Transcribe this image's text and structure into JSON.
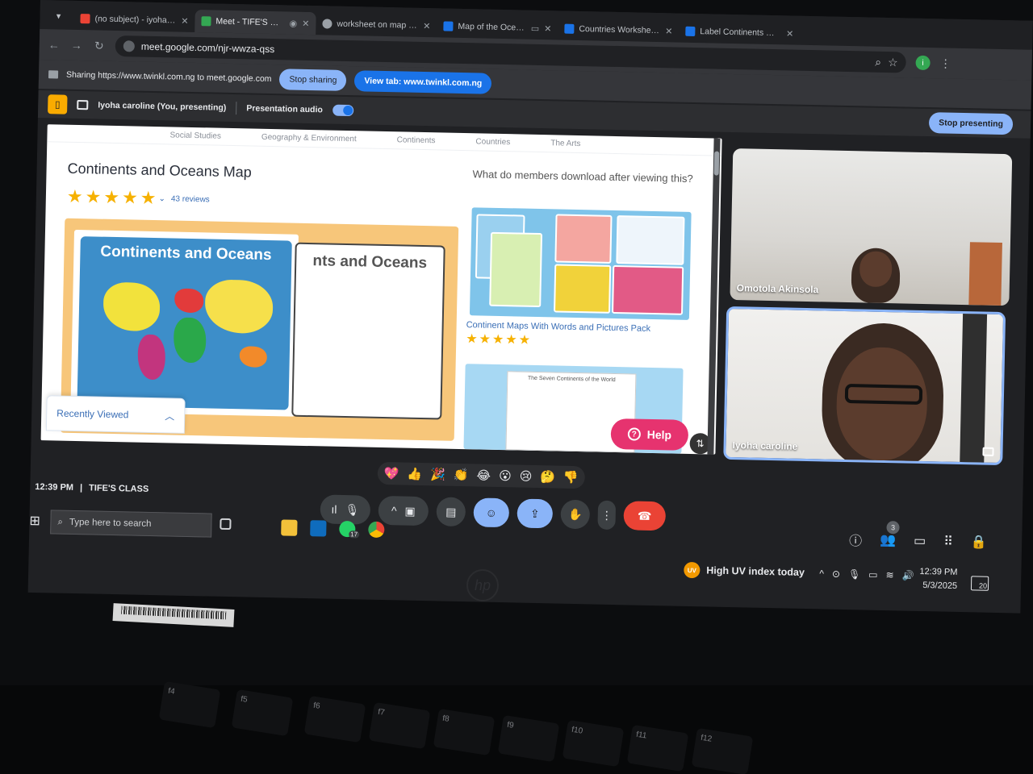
{
  "browser": {
    "tabs": [
      {
        "label": "(no subject) - iyohacaroline",
        "favicon_color": "#ea4335"
      },
      {
        "label": "Meet - TIFE'S CLASS",
        "favicon_color": "#34a853",
        "active": true
      },
      {
        "label": "worksheet on map continents",
        "favicon_color": "#9aa0a6"
      },
      {
        "label": "Map of the Oceans and",
        "favicon_color": "#1a73e8"
      },
      {
        "label": "Countries Worksheets & Pri",
        "favicon_color": "#1a73e8"
      },
      {
        "label": "Label Continents Worksheet",
        "favicon_color": "#1a73e8"
      }
    ],
    "url": "meet.google.com/njr-wwza-qss",
    "profile_initial": "i"
  },
  "sharebar": {
    "text": "Sharing https://www.twinkl.com.ng to meet.google.com",
    "stop_label": "Stop sharing",
    "view_label": "View tab: www.twinkl.com.ng"
  },
  "presentbar": {
    "presenter": "Iyoha caroline (You, presenting)",
    "audio_label": "Presentation audio",
    "stop_label": "Stop presenting"
  },
  "webpage": {
    "nav": [
      "Social Studies",
      "Geography & Environment",
      "Continents",
      "Countries",
      "The Arts"
    ],
    "title": "Continents and Oceans Map",
    "rating": 5,
    "reviews": "43 reviews",
    "preview_front_title": "Continents and Oceans",
    "preview_back_title": "nts and Oceans",
    "recently_viewed": "Recently Viewed",
    "side_question": "What do members download after viewing this?",
    "pack1_title": "Continent Maps With Words and Pictures Pack",
    "pack1_rating": 5,
    "pack2_sheet_title": "The Seven Continents of the World",
    "help_label": "Help"
  },
  "participants": [
    {
      "name": "Omotola Akinsola"
    },
    {
      "name": "Iyoha caroline"
    }
  ],
  "reactions": [
    "💖",
    "👍",
    "🎉",
    "👏",
    "😂",
    "😮",
    "😢",
    "🤔",
    "👎"
  ],
  "meeting": {
    "time": "12:39 PM",
    "name": "TIFE'S CLASS",
    "participant_count": "3"
  },
  "taskbar": {
    "search_placeholder": "Type here to search",
    "whatsapp_badge": "17",
    "weather": "High UV index today",
    "weather_badge": "UV",
    "clock_time": "12:39 PM",
    "clock_date": "5/3/2025",
    "notification_count": "20"
  },
  "laptop": {
    "logo": "hp",
    "keys": [
      "f4",
      "f5",
      "f6",
      "f7",
      "f8",
      "f9",
      "f10",
      "f11",
      "f12"
    ]
  }
}
